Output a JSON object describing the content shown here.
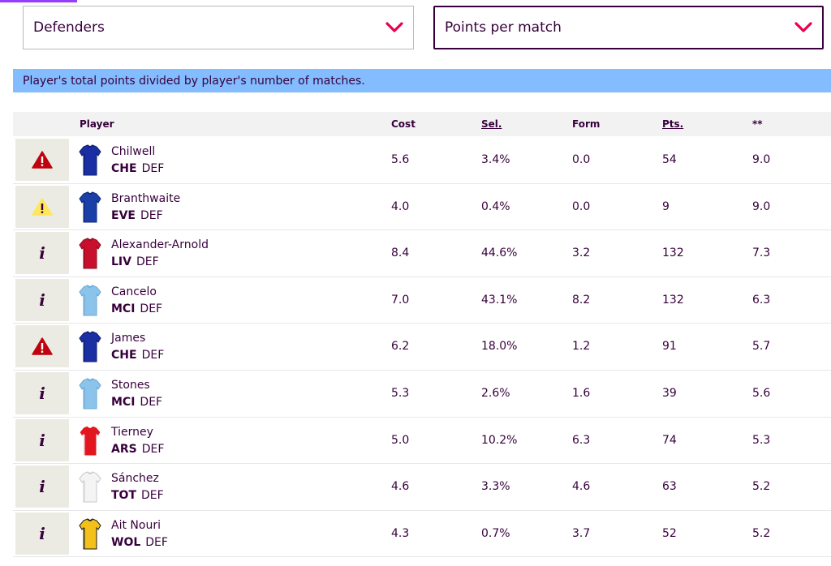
{
  "filters": {
    "view": "Defenders",
    "sort": "Points per match"
  },
  "banner": "Player's total points divided by player's number of matches.",
  "table": {
    "headers": {
      "player": "Player",
      "cost": "Cost",
      "sel": "Sel.",
      "form": "Form",
      "pts": "Pts.",
      "stat": "**"
    },
    "rows": [
      {
        "status": "danger",
        "name": "Chilwell",
        "team": "CHE",
        "pos": "DEF",
        "cost": "5.6",
        "sel": "3.4%",
        "form": "0.0",
        "pts": "54",
        "stat": "9.0",
        "kit": "CHE"
      },
      {
        "status": "doubt",
        "name": "Branthwaite",
        "team": "EVE",
        "pos": "DEF",
        "cost": "4.0",
        "sel": "0.4%",
        "form": "0.0",
        "pts": "9",
        "stat": "9.0",
        "kit": "EVE"
      },
      {
        "status": "info",
        "name": "Alexander-Arnold",
        "team": "LIV",
        "pos": "DEF",
        "cost": "8.4",
        "sel": "44.6%",
        "form": "3.2",
        "pts": "132",
        "stat": "7.3",
        "kit": "LIV"
      },
      {
        "status": "info",
        "name": "Cancelo",
        "team": "MCI",
        "pos": "DEF",
        "cost": "7.0",
        "sel": "43.1%",
        "form": "8.2",
        "pts": "132",
        "stat": "6.3",
        "kit": "MCI"
      },
      {
        "status": "danger",
        "name": "James",
        "team": "CHE",
        "pos": "DEF",
        "cost": "6.2",
        "sel": "18.0%",
        "form": "1.2",
        "pts": "91",
        "stat": "5.7",
        "kit": "CHE"
      },
      {
        "status": "info",
        "name": "Stones",
        "team": "MCI",
        "pos": "DEF",
        "cost": "5.3",
        "sel": "2.6%",
        "form": "1.6",
        "pts": "39",
        "stat": "5.6",
        "kit": "MCI"
      },
      {
        "status": "info",
        "name": "Tierney",
        "team": "ARS",
        "pos": "DEF",
        "cost": "5.0",
        "sel": "10.2%",
        "form": "6.3",
        "pts": "74",
        "stat": "5.3",
        "kit": "ARS"
      },
      {
        "status": "info",
        "name": "Sánchez",
        "team": "TOT",
        "pos": "DEF",
        "cost": "4.6",
        "sel": "3.3%",
        "form": "4.6",
        "pts": "63",
        "stat": "5.2",
        "kit": "TOT"
      },
      {
        "status": "info",
        "name": "Ait Nouri",
        "team": "WOL",
        "pos": "DEF",
        "cost": "4.3",
        "sel": "0.7%",
        "form": "3.7",
        "pts": "52",
        "stat": "5.2",
        "kit": "WOL"
      }
    ]
  },
  "kits": {
    "CHE": {
      "body": "#1a2fa3",
      "trim": "#0f1d6e"
    },
    "EVE": {
      "body": "#1b3fa8",
      "trim": "#0e2a7a"
    },
    "LIV": {
      "body": "#c8102e",
      "trim": "#8e0b20"
    },
    "MCI": {
      "body": "#8cc3ea",
      "trim": "#6aa9d8"
    },
    "ARS": {
      "body": "#e2161e",
      "trim": "#ffffff"
    },
    "TOT": {
      "body": "#f4f4f4",
      "trim": "#c9c9d2"
    },
    "WOL": {
      "body": "#f4c11a",
      "trim": "#1c1c1c"
    }
  },
  "colors": {
    "accent": "#e90052",
    "danger": "#c0020d",
    "doubt": "#ffe65b",
    "text": "#37003c"
  }
}
